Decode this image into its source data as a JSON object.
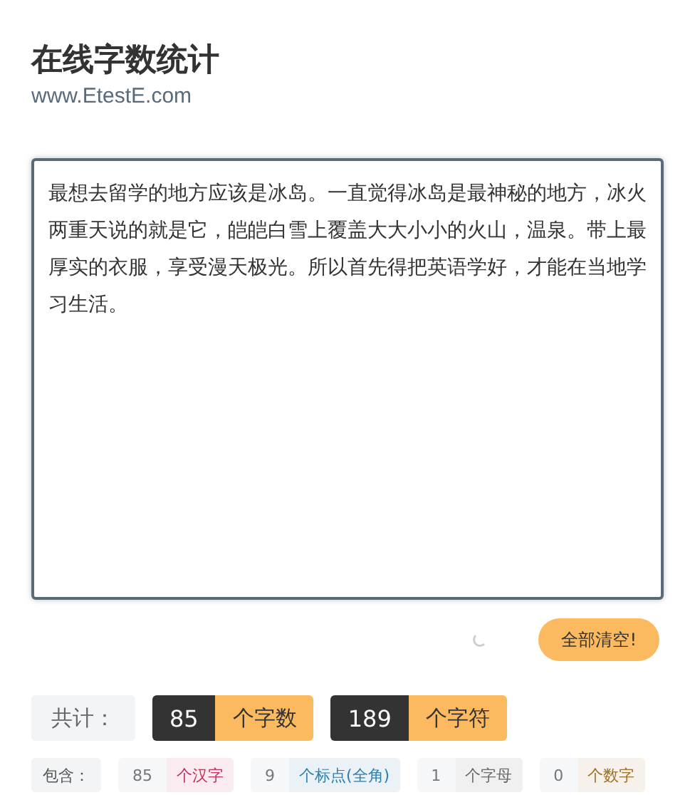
{
  "header": {
    "title": "在线字数统计",
    "subtitle": "www.EtestE.com"
  },
  "editor": {
    "value": "最想去留学的地方应该是冰岛。一直觉得冰岛是最神秘的地方，冰火两重天说的就是它，皑皑白雪上覆盖大大小小的火山，温泉。带上最厚实的衣服，享受漫天极光。所以首先得把英语学好，才能在当地学习生活。"
  },
  "clear_button": {
    "label": "全部清空!"
  },
  "totals": {
    "label": "共计：",
    "items": [
      {
        "count": "85",
        "unit": "个字数"
      },
      {
        "count": "189",
        "unit": "个字符"
      }
    ]
  },
  "details": {
    "label": "包含：",
    "items": [
      {
        "count": "85",
        "unit": "个汉字",
        "color": "#c0335b"
      },
      {
        "count": "9",
        "unit": "个标点(全角)",
        "color": "#2f7fb0"
      },
      {
        "count": "1",
        "unit": "个字母",
        "color": "#6b6b6b"
      },
      {
        "count": "0",
        "unit": "个数字",
        "color": "#a0702a"
      }
    ]
  }
}
